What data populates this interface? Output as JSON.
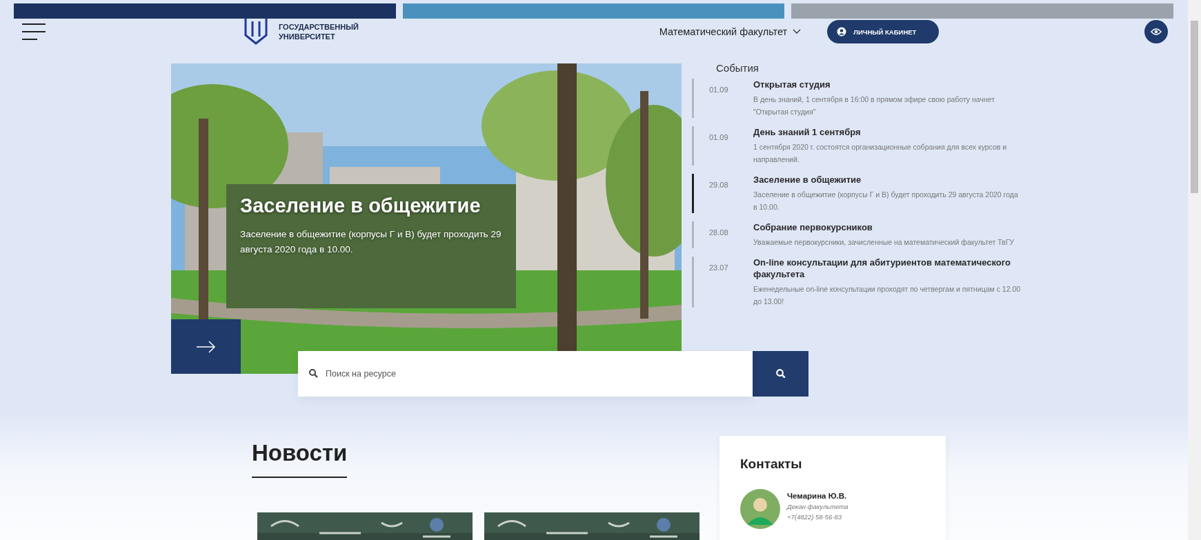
{
  "header": {
    "logo_lines": [
      "ГОСУДАРСТВЕННЫЙ",
      "УНИВЕРСИТЕТ"
    ],
    "faculty_menu": "Математический факультет",
    "account_button": "ЛИЧНЫЙ КАБИНЕТ"
  },
  "hero": {
    "title": "Заселение в общежитие",
    "text": "Заселение в общежитие (корпусы Г и В) будет проходить 29 августа 2020 года в 10.00."
  },
  "events": {
    "title": "События",
    "items": [
      {
        "date": "01.09",
        "title": "Открытая студия",
        "text": "В день знаний, 1 сентября в 16:00 в прямом эфире свою работу начнет \"Открытая студия\"",
        "selected": false
      },
      {
        "date": "01.09",
        "title": "День знаний 1 сентября",
        "text": "1 сентября 2020 г. состоятся организационные собрания для всех курсов и направлений.",
        "selected": false
      },
      {
        "date": "29.08",
        "title": "Заселение в общежитие",
        "text": "Заселение в общежитие (корпусы Г и В) будет проходить 29 августа 2020 года в 10.00.",
        "selected": true
      },
      {
        "date": "28.08",
        "title": "Собрание первокурсников",
        "text": "Уважаемые первокурсники, зачисленные на математический факультет ТвГУ",
        "selected": false
      },
      {
        "date": "23.07",
        "title": "On-line консультации для абитуриентов математического факультета",
        "text": "Еженедельные on-line консультации проходят по четвергам и пятницам с 12.00 до 13.00!",
        "selected": false
      }
    ]
  },
  "search": {
    "placeholder": "Поиск на ресурсе"
  },
  "news": {
    "title": "Новости"
  },
  "contacts": {
    "title": "Контакты",
    "people": [
      {
        "name": "Чемарина Ю.В.",
        "role": "Декан факультета",
        "phone": "+7(4822) 58-56-83"
      }
    ]
  }
}
